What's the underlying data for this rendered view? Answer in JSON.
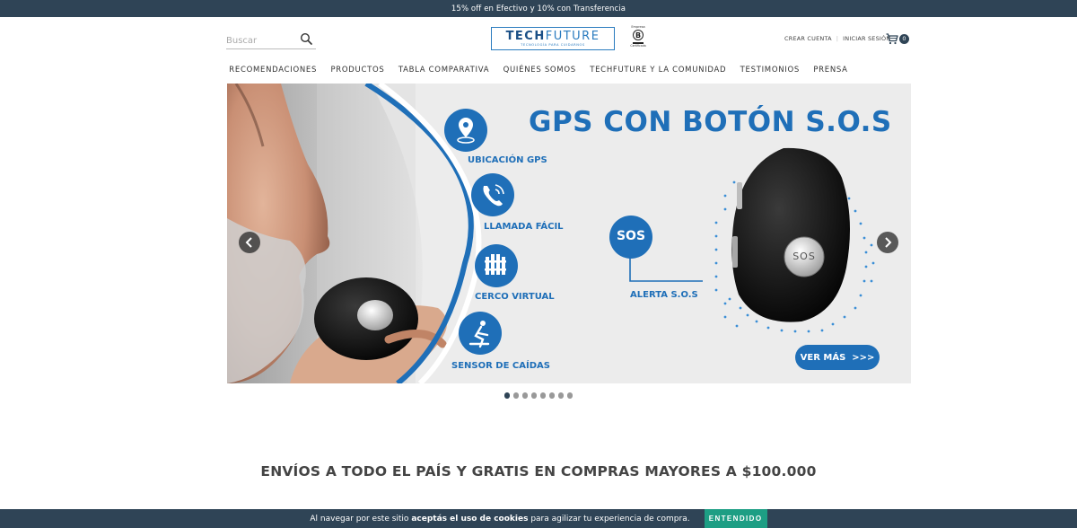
{
  "promo": {
    "text": "15% off en Efectivo y 10% con Transferencia"
  },
  "header": {
    "search_placeholder": "Buscar",
    "logo_main_bold": "TECH",
    "logo_main_thin": "FUTURE",
    "logo_tagline": "TECNOLOGÍA PARA CUIDARNOS",
    "bcorp_top": "Empresa",
    "bcorp_letter": "B",
    "bcorp_bottom": "Certificada",
    "create_account": "CREAR CUENTA",
    "sign_in": "INICIAR SESIÓN",
    "cart_count": "0"
  },
  "nav": {
    "items": [
      {
        "label": "RECOMENDACIONES"
      },
      {
        "label": "PRODUCTOS"
      },
      {
        "label": "TABLA COMPARATIVA"
      },
      {
        "label": "QUIÉNES SOMOS"
      },
      {
        "label": "TECHFUTURE Y LA COMUNIDAD"
      },
      {
        "label": "TESTIMONIOS"
      },
      {
        "label": "PRENSA"
      }
    ]
  },
  "banner": {
    "title": "GPS CON BOTÓN S.O.S",
    "features": [
      {
        "label": "UBICACIÓN GPS",
        "icon": "location-pin-icon"
      },
      {
        "label": "LLAMADA FÁCIL",
        "icon": "phone-icon"
      },
      {
        "label": "CERCO VIRTUAL",
        "icon": "fence-icon"
      },
      {
        "label": "SENSOR DE CAÍDAS",
        "icon": "fall-icon"
      }
    ],
    "sos_badge": "SOS",
    "sos_label": "ALERTA S.O.S",
    "device_button": "SOS",
    "cta": "VER MÁS  >>>",
    "accent": "#1f6fb8",
    "slide_count": 8,
    "active_slide": 1
  },
  "shipping": {
    "text": "ENVÍOS A TODO EL PAÍS Y GRATIS EN COMPRAS MAYORES A $100.000"
  },
  "cookie": {
    "text_before": "Al navegar por este sitio ",
    "text_bold": "aceptás el uso de cookies",
    "text_after": " para agilizar tu experiencia de compra.",
    "button": "ENTENDIDO"
  }
}
